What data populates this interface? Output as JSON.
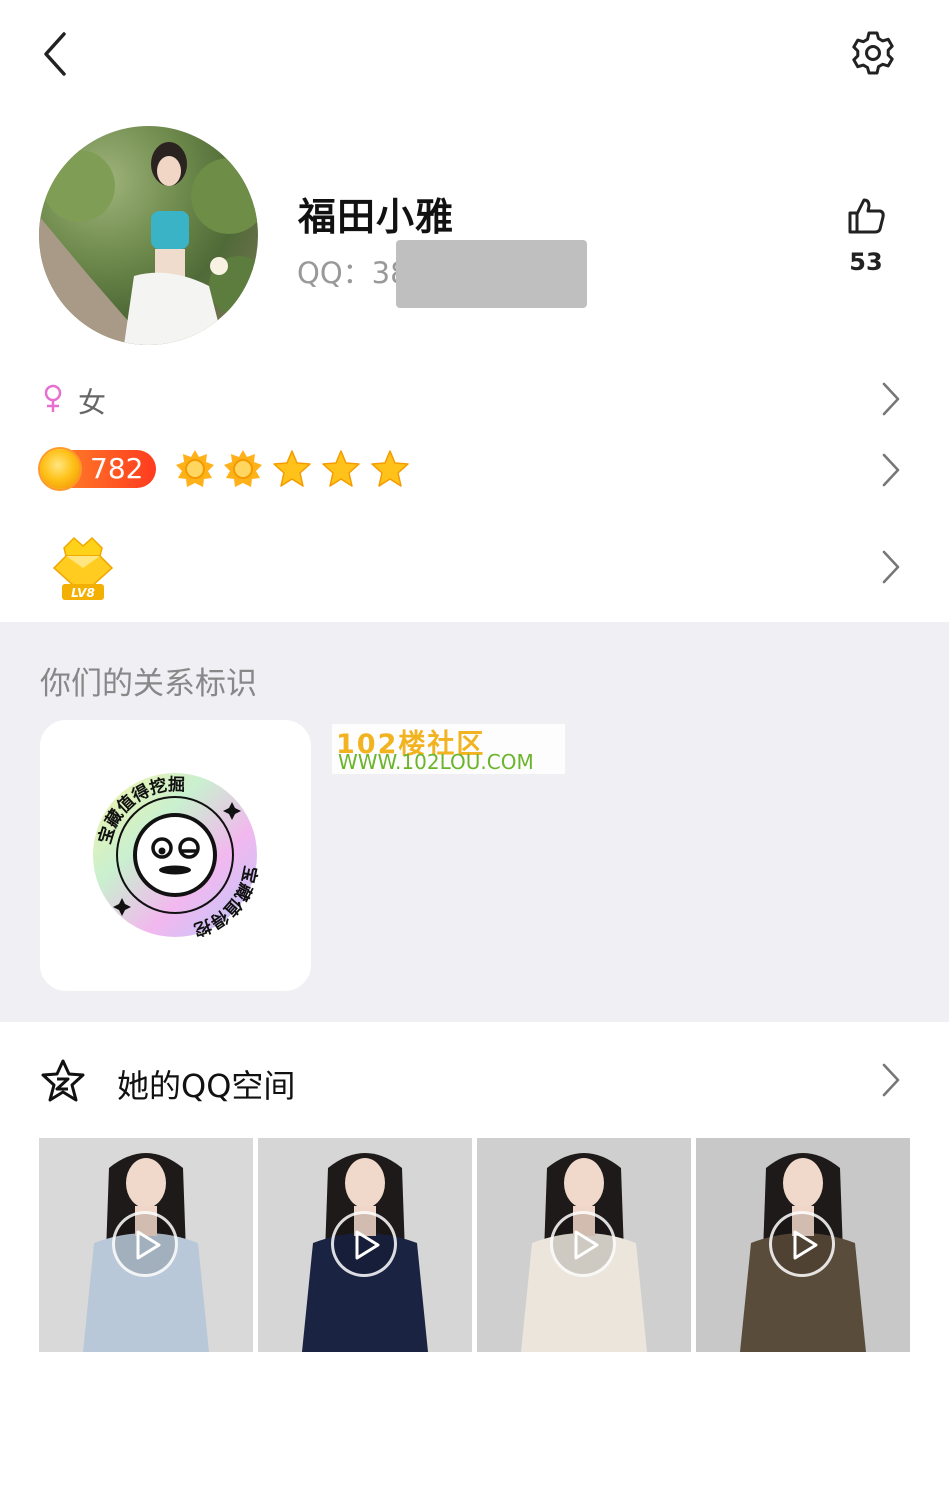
{
  "profile": {
    "name": "福田小雅",
    "qq_label": "QQ：38",
    "likes": "53",
    "gender": "女",
    "level_number": "782",
    "lv_badge": "LV8"
  },
  "relation": {
    "title": "你们的关系标识",
    "badge_text": "宝藏值得挖掘"
  },
  "watermark": {
    "line1": "102楼社区",
    "line2": "WWW.102LOU.COM"
  },
  "qzone": {
    "title": "她的QQ空间",
    "videos": [
      {
        "top": "#d9d9d9",
        "shirt": "#b9c8d8"
      },
      {
        "top": "#d6d6d6",
        "shirt": "#1b2342"
      },
      {
        "top": "#cfcfcf",
        "shirt": "#ebe5dc"
      },
      {
        "top": "#c8c8c8",
        "shirt": "#5a4c3b"
      }
    ]
  },
  "colors": {
    "accent_orange": "#ff5a1f",
    "section_bg": "#efeff4",
    "gender_pink": "#e86fd2"
  }
}
